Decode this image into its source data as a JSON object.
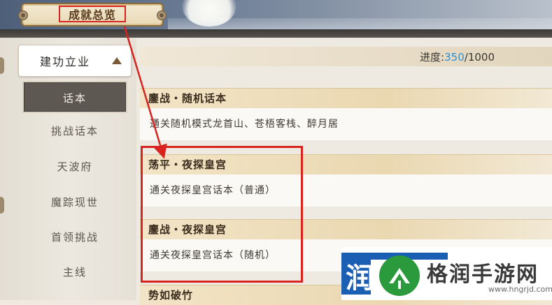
{
  "header": {
    "title": "成就总览"
  },
  "sidebar": {
    "category": "建功立业",
    "items": [
      {
        "label": "话本",
        "active": true
      },
      {
        "label": "挑战话本",
        "active": false
      },
      {
        "label": "天波府",
        "active": false
      },
      {
        "label": "魔踪现世",
        "active": false
      },
      {
        "label": "首领挑战",
        "active": false
      },
      {
        "label": "主线",
        "active": false
      }
    ]
  },
  "progress": {
    "label": "进度:",
    "current": "350",
    "separator": "/",
    "total": "1000"
  },
  "achievements": [
    {
      "title": "鏖战・随机话本",
      "description": "通关随机模式龙首山、苍梧客栈、醉月居"
    },
    {
      "title": "荡平・夜探皇宫",
      "description": "通关夜探皇宫话本（普通）"
    },
    {
      "title": "鏖战・夜探皇宫",
      "description": "通关夜探皇宫话本（随机）"
    },
    {
      "title": "势如破竹",
      "description": ""
    }
  ],
  "watermark": {
    "name": "格润手游网",
    "url": "www.hngrjd.com",
    "badge": "润"
  },
  "colors": {
    "highlight_red": "#d8231e",
    "progress_blue": "#2f8fd0",
    "nav_active_bg": "#5e5852"
  }
}
